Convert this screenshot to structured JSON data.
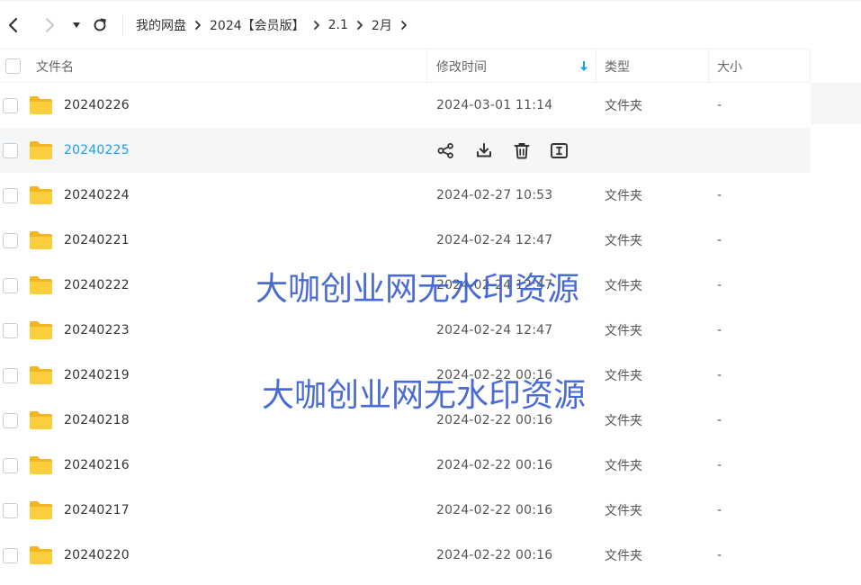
{
  "breadcrumb": [
    "我的网盘",
    "2024【会员版】",
    "2.1",
    "2月"
  ],
  "columns": {
    "name": "文件名",
    "modified": "修改时间",
    "type": "类型",
    "size": "大小"
  },
  "colors": {
    "accent": "#1a9ee6",
    "folder": "#f7c232",
    "watermark": "#3a5fd0"
  },
  "files": [
    {
      "name": "20240226",
      "modified": "2024-03-01 11:14",
      "type": "文件夹",
      "size": "-"
    },
    {
      "name": "20240225",
      "modified": "",
      "type": "",
      "size": ""
    },
    {
      "name": "20240224",
      "modified": "2024-02-27 10:53",
      "type": "文件夹",
      "size": "-"
    },
    {
      "name": "20240221",
      "modified": "2024-02-24 12:47",
      "type": "文件夹",
      "size": "-"
    },
    {
      "name": "20240222",
      "modified": "2024-02-24 12:47",
      "type": "文件夹",
      "size": "-"
    },
    {
      "name": "20240223",
      "modified": "2024-02-24 12:47",
      "type": "文件夹",
      "size": "-"
    },
    {
      "name": "20240219",
      "modified": "2024-02-22 00:16",
      "type": "文件夹",
      "size": "-"
    },
    {
      "name": "20240218",
      "modified": "2024-02-22 00:16",
      "type": "文件夹",
      "size": "-"
    },
    {
      "name": "20240216",
      "modified": "2024-02-22 00:16",
      "type": "文件夹",
      "size": "-"
    },
    {
      "name": "20240217",
      "modified": "2024-02-22 00:16",
      "type": "文件夹",
      "size": "-"
    },
    {
      "name": "20240220",
      "modified": "2024-02-22 00:16",
      "type": "文件夹",
      "size": "-"
    }
  ],
  "row_actions": [
    "share-icon",
    "download-icon",
    "delete-icon",
    "rename-icon"
  ],
  "watermarks": [
    "大咖创业网无水印资源",
    "大咖创业网无水印资源"
  ]
}
